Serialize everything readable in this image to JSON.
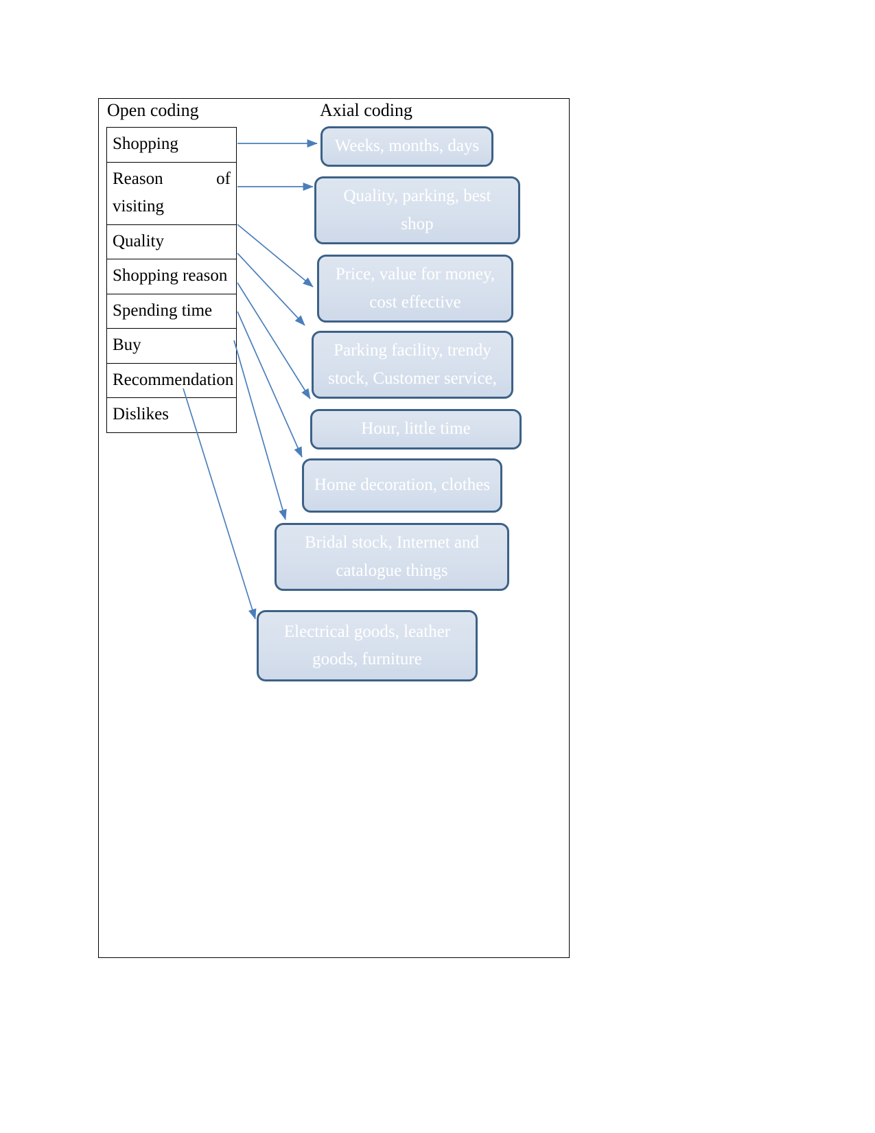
{
  "figure": {
    "headings": {
      "open_coding": "Open coding",
      "axial_coding": "Axial coding"
    },
    "open_codes": [
      {
        "label": "Shopping",
        "justify": false
      },
      {
        "label": "Reason of visiting",
        "justify": true
      },
      {
        "label": "Quality",
        "justify": false
      },
      {
        "label": "Shopping reason",
        "justify": false
      },
      {
        "label": "Spending time",
        "justify": false
      },
      {
        "label": "Buy",
        "justify": false
      },
      {
        "label": "Recommendation",
        "justify": false
      },
      {
        "label": "Dislikes",
        "justify": false
      }
    ],
    "axial_categories": [
      {
        "label": "Weeks, months, days"
      },
      {
        "label": "Quality, parking, best shop"
      },
      {
        "label": "Price, value for money, cost effective"
      },
      {
        "label": "Parking facility, trendy stock, Customer service,"
      },
      {
        "label": "Hour, little time"
      },
      {
        "label": "Home decoration, clothes"
      },
      {
        "label": "Bridal stock, Internet and catalogue things"
      },
      {
        "label": "Electrical goods, leather goods, furniture"
      }
    ],
    "connections": [
      {
        "from": "Shopping",
        "to": "Weeks, months, days"
      },
      {
        "from": "Reason of visiting",
        "to": "Quality, parking, best shop"
      },
      {
        "from": "Quality",
        "to": "Price, value for money, cost effective"
      },
      {
        "from": "Shopping reason",
        "to": "Parking facility, trendy stock, Customer service,"
      },
      {
        "from": "Spending time",
        "to": "Hour, little time"
      },
      {
        "from": "Buy",
        "to": "Home decoration, clothes"
      },
      {
        "from": "Recommendation",
        "to": "Bridal stock, Internet and catalogue things"
      },
      {
        "from": "Dislikes",
        "to": "Electrical goods, leather goods, furniture"
      }
    ],
    "colors": {
      "box_border": "#3c6186",
      "box_fill": "#dce4ef",
      "box_text": "#ffffff",
      "arrow": "#4a7ebb",
      "frame_border": "#000000",
      "table_border": "#000000",
      "table_text": "#000000"
    }
  }
}
